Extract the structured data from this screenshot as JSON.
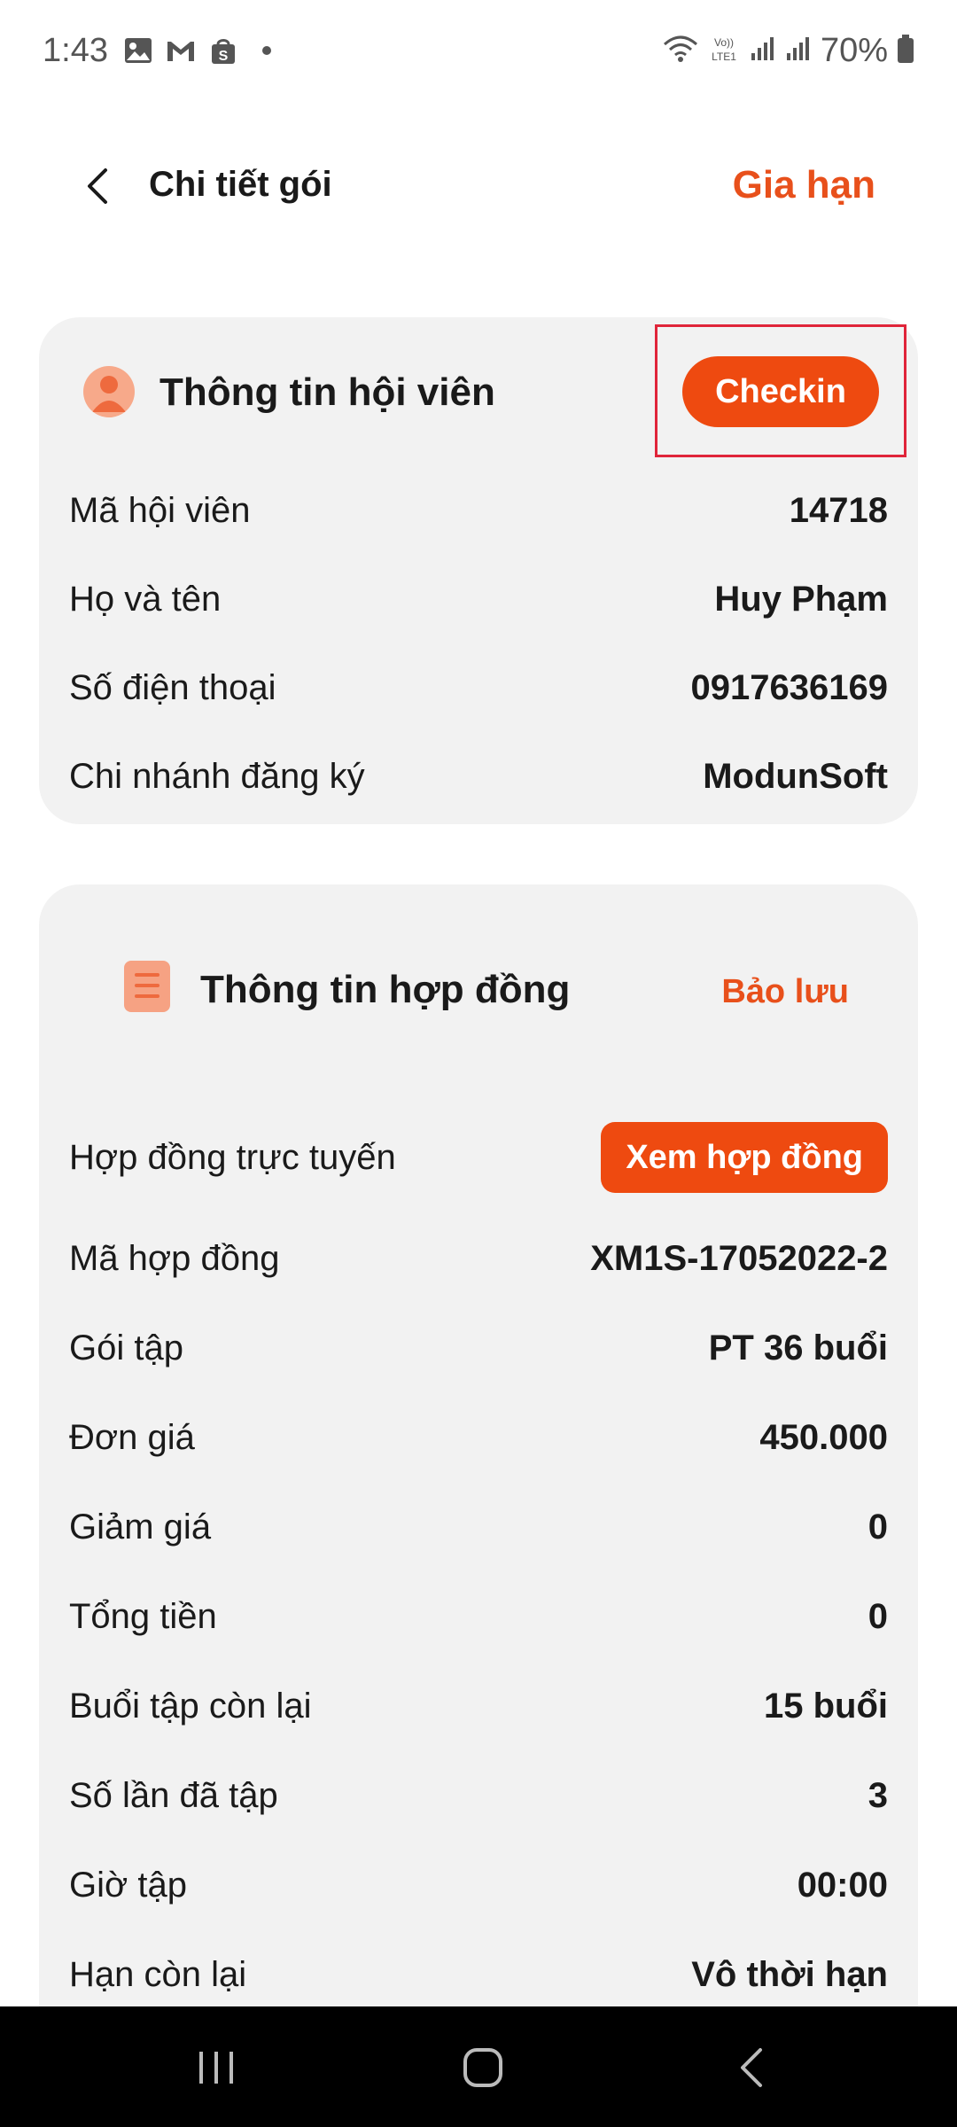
{
  "status_bar": {
    "time": "1:43",
    "battery": "70%",
    "icons": [
      "image-icon",
      "gmail-icon",
      "shopee-icon",
      "notification-dot",
      "wifi-icon",
      "volte-icon",
      "signal-icon",
      "signal-icon",
      "battery-icon"
    ]
  },
  "header": {
    "title": "Chi tiết gói",
    "renew_label": "Gia hạn"
  },
  "member_card": {
    "title": "Thông tin hội viên",
    "checkin_label": "Checkin",
    "rows": [
      {
        "label": "Mã hội viên",
        "value": "14718"
      },
      {
        "label": "Họ và tên",
        "value": "Huy Phạm"
      },
      {
        "label": "Số điện thoại",
        "value": "0917636169"
      },
      {
        "label": "Chi nhánh đăng ký",
        "value": "ModunSoft"
      }
    ]
  },
  "contract_card": {
    "title": "Thông tin hợp đồng",
    "save_label": "Bảo lưu",
    "online_contract_label": "Hợp đồng trực tuyến",
    "view_contract_label": "Xem hợp đồng",
    "rows": [
      {
        "label": "Mã hợp đồng",
        "value": "XM1S-17052022-2"
      },
      {
        "label": "Gói tập",
        "value": "PT 36 buổi"
      },
      {
        "label": "Đơn giá",
        "value": "450.000"
      },
      {
        "label": "Giảm giá",
        "value": "0"
      },
      {
        "label": "Tổng tiền",
        "value": "0"
      },
      {
        "label": "Buổi tập còn lại",
        "value": "15 buổi"
      },
      {
        "label": "Số lần đã tập",
        "value": "3"
      },
      {
        "label": "Giờ tập",
        "value": "00:00"
      },
      {
        "label": "Hạn còn lại",
        "value": "Vô thời hạn"
      }
    ]
  },
  "colors": {
    "accent": "#ee4a10",
    "card_bg": "#f2f2f2",
    "highlight": "#e0253a"
  }
}
